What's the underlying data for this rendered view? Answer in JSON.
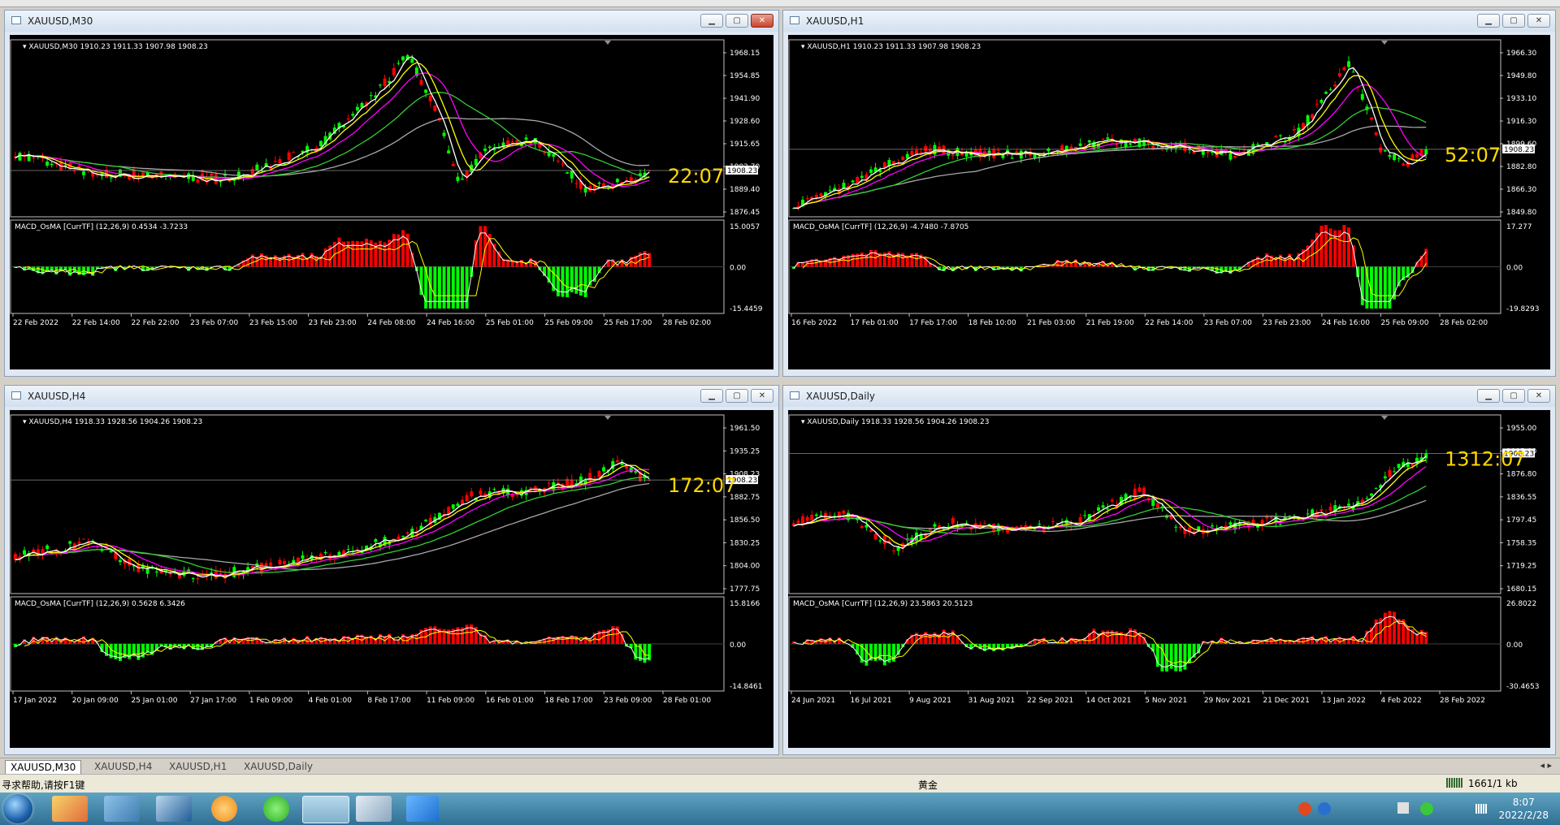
{
  "windows": [
    {
      "id": "m30",
      "title": "XAUUSD,M30",
      "active": true,
      "info": "XAUUSD,M30  1910.23 1911.33 1907.98 1908.23",
      "price_ticks": [
        "1968.15",
        "1954.85",
        "1941.90",
        "1928.60",
        "1915.65",
        "1902.70",
        "1889.40",
        "1876.45"
      ],
      "current_price": "1908.23",
      "timer": "22:07",
      "macd_label": "MACD_OsMA [CurrTF] (12,26,9) 0.4534 -3.7233",
      "macd_ticks": [
        "15.0057",
        "0.00",
        "-15.4459"
      ],
      "time_ticks": [
        "22 Feb 2022",
        "22 Feb 14:00",
        "22 Feb 22:00",
        "23 Feb 07:00",
        "23 Feb 15:00",
        "23 Feb 23:00",
        "24 Feb 08:00",
        "24 Feb 16:00",
        "25 Feb 01:00",
        "25 Feb 09:00",
        "25 Feb 17:00",
        "28 Feb 02:00"
      ]
    },
    {
      "id": "h1",
      "title": "XAUUSD,H1",
      "active": false,
      "info": "XAUUSD,H1  1910.23 1911.33 1907.98 1908.23",
      "price_ticks": [
        "1966.30",
        "1949.80",
        "1933.10",
        "1916.30",
        "1899.60",
        "1882.80",
        "1866.30",
        "1849.80"
      ],
      "current_price": "1908.23",
      "timer": "52:07",
      "macd_label": "MACD_OsMA [CurrTF] (12,26,9) -4.7480 -7.8705",
      "macd_ticks": [
        "17.277",
        "0.00",
        "-19.8293"
      ],
      "time_ticks": [
        "16 Feb 2022",
        "17 Feb 01:00",
        "17 Feb 17:00",
        "18 Feb 10:00",
        "21 Feb 03:00",
        "21 Feb 19:00",
        "22 Feb 14:00",
        "23 Feb 07:00",
        "23 Feb 23:00",
        "24 Feb 16:00",
        "25 Feb 09:00",
        "28 Feb 02:00"
      ]
    },
    {
      "id": "h4",
      "title": "XAUUSD,H4",
      "active": false,
      "info": "XAUUSD,H4  1918.33 1928.56 1904.26 1908.23",
      "price_ticks": [
        "1961.50",
        "1935.25",
        "1908.23",
        "1882.75",
        "1856.50",
        "1830.25",
        "1804.00",
        "1777.75"
      ],
      "current_price": "1908.23",
      "timer": "172:07",
      "macd_label": "MACD_OsMA [CurrTF] (12,26,9) 0.5628 6.3426",
      "macd_ticks": [
        "15.8166",
        "0.00",
        "-14.8461"
      ],
      "time_ticks": [
        "17 Jan 2022",
        "20 Jan 09:00",
        "25 Jan 01:00",
        "27 Jan 17:00",
        "1 Feb 09:00",
        "4 Feb 01:00",
        "8 Feb 17:00",
        "11 Feb 09:00",
        "16 Feb 01:00",
        "18 Feb 17:00",
        "23 Feb 09:00",
        "28 Feb 01:00"
      ]
    },
    {
      "id": "d1",
      "title": "XAUUSD,Daily",
      "active": false,
      "info": "XAUUSD,Daily  1918.33 1928.56 1904.26 1908.23",
      "price_ticks": [
        "1955.00",
        "1915.00",
        "1876.80",
        "1836.55",
        "1797.45",
        "1758.35",
        "1719.25",
        "1680.15"
      ],
      "current_price": "1908.23",
      "timer": "1312:07",
      "macd_label": "MACD_OsMA [CurrTF] (12,26,9) 23.5863 20.5123",
      "macd_ticks": [
        "26.8022",
        "0.00",
        "-30.4653"
      ],
      "time_ticks": [
        "24 Jun 2021",
        "16 Jul 2021",
        "9 Aug 2021",
        "31 Aug 2021",
        "22 Sep 2021",
        "14 Oct 2021",
        "5 Nov 2021",
        "29 Nov 2021",
        "21 Dec 2021",
        "13 Jan 2022",
        "4 Feb 2022",
        "28 Feb 2022"
      ]
    }
  ],
  "tabs": [
    "XAUUSD,M30",
    "XAUUSD,H4",
    "XAUUSD,H1",
    "XAUUSD,Daily"
  ],
  "status": {
    "help": "寻求帮助,请按F1键",
    "symbol": "黄金",
    "traffic": "1661/1 kb"
  },
  "clock": {
    "time": "8:07",
    "date": "2022/2/28"
  },
  "colors": {
    "background": "#000000",
    "bull": "#00ff00",
    "bear": "#ff0000",
    "ma_white": "#ffffff",
    "ma_yellow": "#ffff00",
    "ma_magenta": "#ff00ff",
    "ma_green": "#33cc33",
    "ma_gray": "#a8a8a8",
    "timer": "#ffd700"
  },
  "icons": [
    "windows-start-icon",
    "paint-icon",
    "network-icon",
    "display-icon",
    "refresh-icon",
    "wechat-icon",
    "mt4-icon",
    "notes-icon",
    "mail-icon"
  ]
}
